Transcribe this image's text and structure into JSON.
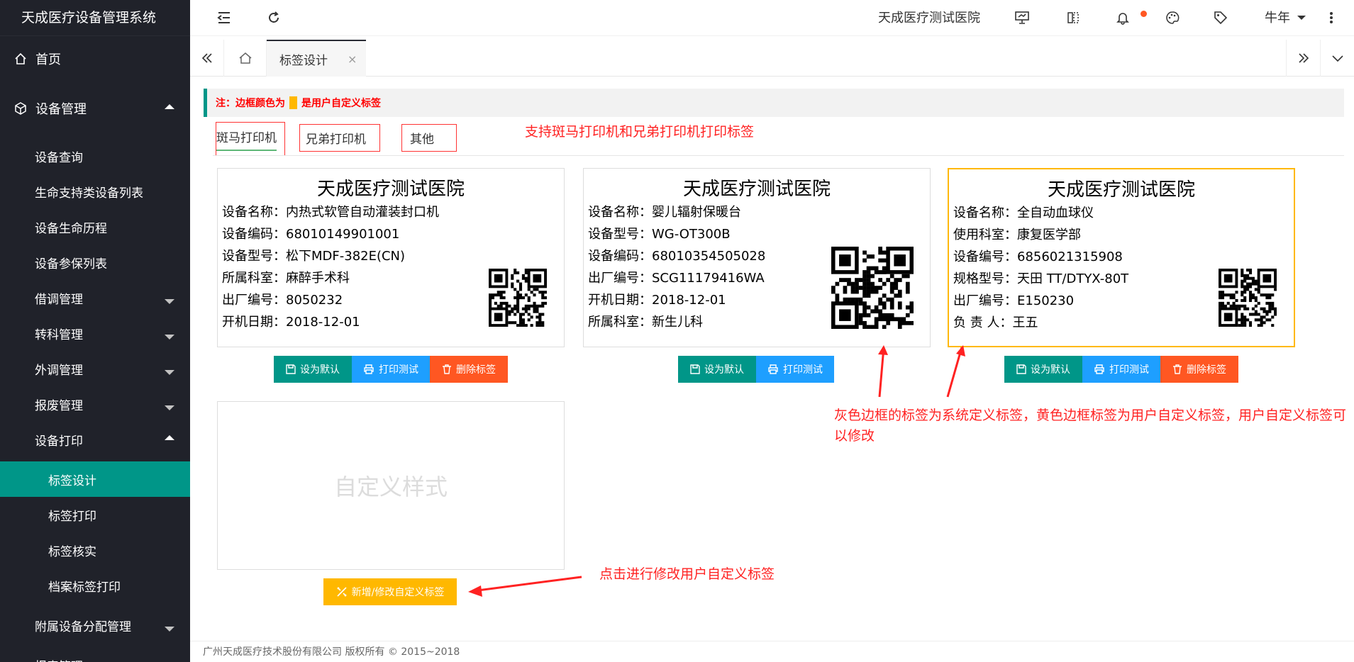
{
  "app": {
    "title": "天成医疗设备管理系统"
  },
  "sidebar": {
    "items": [
      {
        "label": "首页"
      },
      {
        "label": "设备管理"
      },
      {
        "label": "设备查询"
      },
      {
        "label": "生命支持类设备列表"
      },
      {
        "label": "设备生命历程"
      },
      {
        "label": "设备参保列表"
      },
      {
        "label": "借调管理"
      },
      {
        "label": "转科管理"
      },
      {
        "label": "外调管理"
      },
      {
        "label": "报废管理"
      },
      {
        "label": "设备打印"
      },
      {
        "label": "标签设计"
      },
      {
        "label": "标签打印"
      },
      {
        "label": "标签核实"
      },
      {
        "label": "档案标签打印"
      },
      {
        "label": "附属设备分配管理"
      },
      {
        "label": "报表管理"
      }
    ]
  },
  "header": {
    "hospital": "天成医疗测试医院",
    "user": "牛年"
  },
  "tabs": {
    "active_label": "标签设计",
    "close": "×"
  },
  "note": {
    "prefix": "注：边框颜色为",
    "suffix": "是用户自定义标签",
    "swatch_color": "#ffb800"
  },
  "printer_tabs": [
    {
      "label": "斑马打印机"
    },
    {
      "label": "兄弟打印机"
    },
    {
      "label": "其他"
    }
  ],
  "annotations": {
    "printer_support": "支持斑马打印机和兄弟打印机打印标签",
    "border_explain": "灰色边框的标签为系统定义标签，黄色边框标签为用户自定义标签，用户自定义标签可以修改",
    "click_hint": "点击进行修改用户自定义标签"
  },
  "cards": [
    {
      "title": "天成医疗测试医院",
      "fields": [
        "设备名称：内热式软管自动灌装封口机",
        "设备编码：68010149901001",
        "设备型号：松下MDF-382E(CN)",
        "所属科室：麻醉手术科",
        "出厂编号：8050232",
        "开机日期：2018-12-01"
      ]
    },
    {
      "title": "天成医疗测试医院",
      "fields": [
        "设备名称：婴儿辐射保暖台",
        "设备型号：WG-OT300B",
        "设备编码：68010354505028",
        "出厂编号：SCG11179416WA",
        "开机日期：2018-12-01",
        "所属科室：新生儿科"
      ]
    },
    {
      "title": "天成医疗测试医院",
      "fields": [
        "设备名称：全自动血球仪",
        "使用科室：康复医学部",
        "设备编号：6856021315908",
        "规格型号：天田 TT/DTYX-80T",
        "出厂编号：E150230",
        "负 责 人：王五"
      ]
    }
  ],
  "buttons": {
    "set_default": "设为默认",
    "print_test": "打印测试",
    "delete_label": "删除标签",
    "add_modify": "新增/修改自定义标签"
  },
  "custom_card": {
    "label": "自定义样式"
  },
  "footer": {
    "text": "广州天成医疗技术股份有限公司 版权所有 © 2015~2018"
  },
  "colors": {
    "sidebar_bg": "#20222a",
    "active_menu": "#009688",
    "btn_green": "#009688",
    "btn_blue": "#1e9fff",
    "btn_orange": "#ff5722",
    "btn_yellow": "#ffb800",
    "annotation_red": "#ff2222"
  }
}
